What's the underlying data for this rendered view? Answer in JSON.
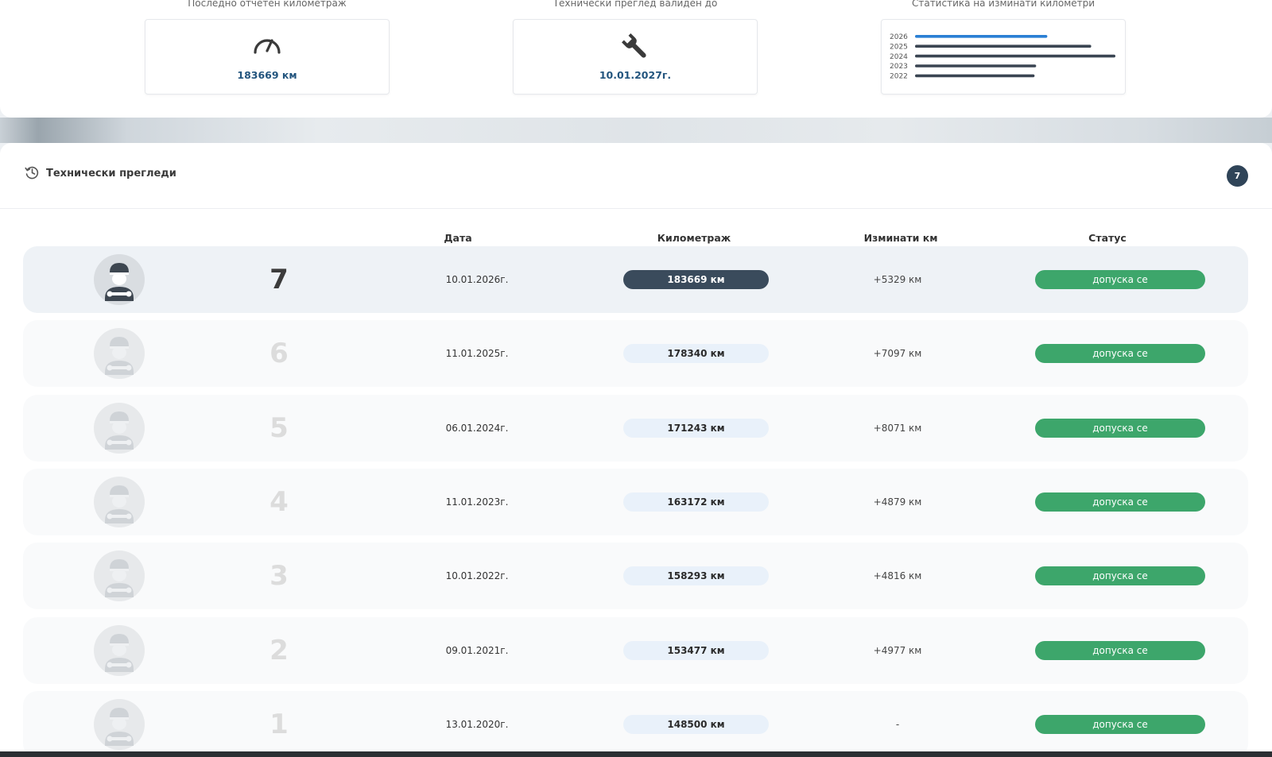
{
  "stats": {
    "mileage": {
      "title": "Последно отчетен километраж",
      "value": "183669 км",
      "icon": "speedometer-icon"
    },
    "inspection": {
      "title": "Технически преглед валиден до",
      "value": "10.01.2027г.",
      "icon": "wrench-icon"
    },
    "km_stats": {
      "title": "Статистика на изминати километри",
      "chart_data": {
        "type": "bar",
        "orientation": "horizontal",
        "categories": [
          "2026",
          "2025",
          "2024",
          "2023",
          "2022"
        ],
        "values": [
          5329,
          7097,
          8071,
          4879,
          4816
        ],
        "colors": [
          "#2a7fd4",
          "#3a4552",
          "#3a4552",
          "#3a4552",
          "#3a4552"
        ],
        "xlim": [
          0,
          8071
        ]
      }
    }
  },
  "inspections": {
    "title": "Технически прегледи",
    "title_icon": "history-icon",
    "count": "7",
    "columns": {
      "date": "Дата",
      "mileage": "Километраж",
      "delta": "Изминати км",
      "status": "Статус"
    },
    "rows": [
      {
        "num": "7",
        "date": "10.01.2026г.",
        "km": "183669 км",
        "delta": "+5329 км",
        "status": "допуска се",
        "active": true
      },
      {
        "num": "6",
        "date": "11.01.2025г.",
        "km": "178340 км",
        "delta": "+7097 км",
        "status": "допуска се",
        "active": false
      },
      {
        "num": "5",
        "date": "06.01.2024г.",
        "km": "171243 км",
        "delta": "+8071 км",
        "status": "допуска се",
        "active": false
      },
      {
        "num": "4",
        "date": "11.01.2023г.",
        "km": "163172 км",
        "delta": "+4879 км",
        "status": "допуска се",
        "active": false
      },
      {
        "num": "3",
        "date": "10.01.2022г.",
        "km": "158293 км",
        "delta": "+4816 км",
        "status": "допуска се",
        "active": false
      },
      {
        "num": "2",
        "date": "09.01.2021г.",
        "km": "153477 км",
        "delta": "+4977 км",
        "status": "допуска се",
        "active": false
      },
      {
        "num": "1",
        "date": "13.01.2020г.",
        "km": "148500 км",
        "delta": "-",
        "status": "допуска се",
        "active": false
      }
    ]
  },
  "colors": {
    "accent": "#23557e",
    "status_green": "#3da66b",
    "badge_dark": "#2f4458",
    "pill_active": "#3a4b5c",
    "pill_light": "#e9f1fa"
  }
}
